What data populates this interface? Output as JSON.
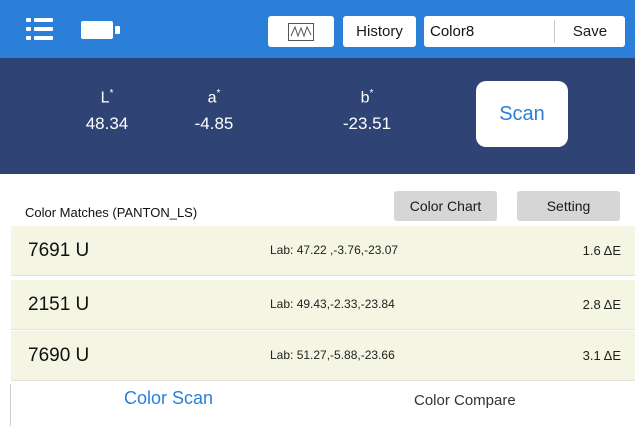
{
  "toolbar": {
    "menu_icon": "menu-icon",
    "battery_icon": "battery-icon",
    "chart_icon": "waveform-chart-icon",
    "history_label": "History",
    "name_value": "Color8",
    "save_label": "Save",
    "accent_color": "#2b7fd9"
  },
  "lab": {
    "l_label": "L",
    "l_value": "48.34",
    "a_label": "a",
    "a_value": "-4.85",
    "b_label": "b",
    "b_value": "-23.51",
    "star": "*",
    "scan_label": "Scan",
    "panel_color": "#2f4375"
  },
  "matches": {
    "title": "Color Matches (PANTON_LS)",
    "color_chart_label": "Color Chart",
    "setting_label": "Setting",
    "rows": [
      {
        "name": "7691 U",
        "lab": "Lab: 47.22 ,-3.76,-23.07",
        "delta": "1.6 ΔE"
      },
      {
        "name": "2151 U",
        "lab": "Lab: 49.43,-2.33,-23.84",
        "delta": "2.8 ΔE"
      },
      {
        "name": "7690 U",
        "lab": "Lab: 51.27,-5.88,-23.66",
        "delta": "3.1 ΔE"
      }
    ]
  },
  "tabs": {
    "scan": "Color Scan",
    "compare": "Color Compare"
  }
}
